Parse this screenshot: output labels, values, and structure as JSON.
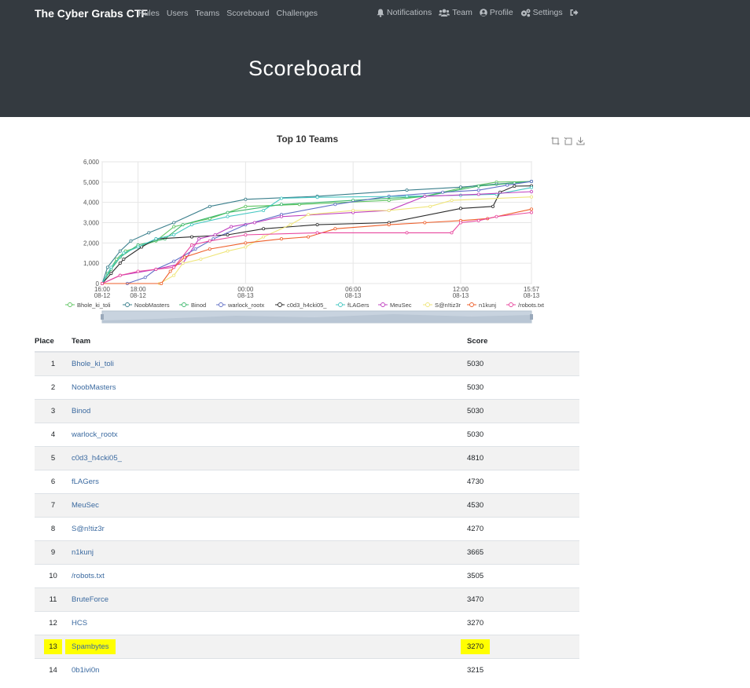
{
  "navbar": {
    "brand": "The Cyber Grabs CTF",
    "links": [
      "Rules",
      "Users",
      "Teams",
      "Scoreboard",
      "Challenges"
    ],
    "right": {
      "notifications": "Notifications",
      "team": "Team",
      "profile": "Profile",
      "settings": "Settings"
    }
  },
  "page": {
    "title": "Scoreboard"
  },
  "table": {
    "headers": {
      "place": "Place",
      "team": "Team",
      "score": "Score"
    },
    "rows": [
      {
        "place": "1",
        "team": "Bhole_ki_toli",
        "score": "5030"
      },
      {
        "place": "2",
        "team": "NoobMasters",
        "score": "5030"
      },
      {
        "place": "3",
        "team": "Binod",
        "score": "5030"
      },
      {
        "place": "4",
        "team": "warlock_rootx",
        "score": "5030"
      },
      {
        "place": "5",
        "team": "c0d3_h4cki05_",
        "score": "4810"
      },
      {
        "place": "6",
        "team": "fLAGers",
        "score": "4730"
      },
      {
        "place": "7",
        "team": "MeuSec",
        "score": "4530"
      },
      {
        "place": "8",
        "team": "S@n!tiz3r",
        "score": "4270"
      },
      {
        "place": "9",
        "team": "n1kunj",
        "score": "3665"
      },
      {
        "place": "10",
        "team": "/robots.txt",
        "score": "3505"
      },
      {
        "place": "11",
        "team": "BruteForce",
        "score": "3470"
      },
      {
        "place": "12",
        "team": "HCS",
        "score": "3270"
      },
      {
        "place": "13",
        "team": "Spambytes",
        "score": "3270",
        "highlighted": true
      },
      {
        "place": "14",
        "team": "0b1ivi0n",
        "score": "3215"
      }
    ]
  },
  "chart_data": {
    "type": "line",
    "title": "Top 10 Teams",
    "xlabel": "",
    "ylabel": "",
    "ylim": [
      0,
      6000
    ],
    "xlim_hours": [
      0,
      23.95
    ],
    "y_ticks": [
      "0",
      "1,000",
      "2,000",
      "3,000",
      "4,000",
      "5,000",
      "6,000"
    ],
    "x_ticks": [
      {
        "h": 0,
        "time": "16:00",
        "date": "08-12"
      },
      {
        "h": 2,
        "time": "18:00",
        "date": "08-12"
      },
      {
        "h": 8,
        "time": "00:00",
        "date": "08-13"
      },
      {
        "h": 14,
        "time": "06:00",
        "date": "08-13"
      },
      {
        "h": 20,
        "time": "12:00",
        "date": "08-13"
      },
      {
        "h": 23.95,
        "time": "15:57",
        "date": "08-13"
      }
    ],
    "grid": true,
    "legend_position": "bottom",
    "series": [
      {
        "name": "Bhole_ki_toli",
        "color": "#5ec460",
        "points": [
          [
            0,
            0
          ],
          [
            0.3,
            500
          ],
          [
            0.8,
            1200
          ],
          [
            1.3,
            1600
          ],
          [
            2,
            1800
          ],
          [
            3,
            2100
          ],
          [
            4,
            2800
          ],
          [
            6,
            3200
          ],
          [
            8,
            3800
          ],
          [
            11,
            3900
          ],
          [
            16,
            4100
          ],
          [
            18,
            4300
          ],
          [
            20,
            4700
          ],
          [
            22,
            5000
          ],
          [
            23.95,
            5030
          ]
        ]
      },
      {
        "name": "NoobMasters",
        "color": "#3a7f8c",
        "points": [
          [
            0,
            0
          ],
          [
            0.3,
            800
          ],
          [
            1,
            1600
          ],
          [
            1.6,
            2100
          ],
          [
            2.6,
            2500
          ],
          [
            4,
            3000
          ],
          [
            6,
            3800
          ],
          [
            8,
            4150
          ],
          [
            12,
            4300
          ],
          [
            17,
            4600
          ],
          [
            20,
            4750
          ],
          [
            22,
            4900
          ],
          [
            23.95,
            5030
          ]
        ]
      },
      {
        "name": "Binod",
        "color": "#3db86d",
        "points": [
          [
            0,
            0
          ],
          [
            0.5,
            700
          ],
          [
            1,
            1300
          ],
          [
            2,
            1900
          ],
          [
            3.5,
            2200
          ],
          [
            4.5,
            2900
          ],
          [
            7,
            3500
          ],
          [
            10,
            3900
          ],
          [
            14,
            4100
          ],
          [
            18,
            4300
          ],
          [
            21,
            4800
          ],
          [
            23,
            4950
          ],
          [
            23.95,
            5030
          ]
        ]
      },
      {
        "name": "warlock_rootx",
        "color": "#6170c6",
        "points": [
          [
            0,
            0
          ],
          [
            1.4,
            0
          ],
          [
            2.4,
            300
          ],
          [
            3,
            700
          ],
          [
            4,
            1100
          ],
          [
            5.2,
            1700
          ],
          [
            6.2,
            2200
          ],
          [
            8,
            2900
          ],
          [
            10,
            3400
          ],
          [
            13,
            3900
          ],
          [
            16,
            4300
          ],
          [
            19,
            4500
          ],
          [
            21,
            4600
          ],
          [
            22.6,
            4850
          ],
          [
            23.95,
            5030
          ]
        ]
      },
      {
        "name": "c0d3_h4cki05_",
        "color": "#2b2b2b",
        "points": [
          [
            0,
            0
          ],
          [
            0.5,
            500
          ],
          [
            1,
            1000
          ],
          [
            1.2,
            1200
          ],
          [
            2.2,
            1800
          ],
          [
            3,
            2200
          ],
          [
            5,
            2300
          ],
          [
            7,
            2400
          ],
          [
            9,
            2700
          ],
          [
            12,
            2900
          ],
          [
            16,
            3000
          ],
          [
            20,
            3700
          ],
          [
            21.8,
            3800
          ],
          [
            22.2,
            4500
          ],
          [
            23,
            4800
          ],
          [
            23.95,
            4810
          ]
        ]
      },
      {
        "name": "fLAGers",
        "color": "#45c7c2",
        "points": [
          [
            0,
            0
          ],
          [
            0.5,
            800
          ],
          [
            1.2,
            1500
          ],
          [
            2,
            1800
          ],
          [
            3,
            2200
          ],
          [
            4,
            2400
          ],
          [
            5,
            2900
          ],
          [
            7,
            3300
          ],
          [
            9,
            3600
          ],
          [
            10,
            4200
          ],
          [
            12,
            4250
          ],
          [
            17,
            4300
          ],
          [
            20,
            4350
          ],
          [
            22,
            4400
          ],
          [
            23.95,
            4730
          ]
        ]
      },
      {
        "name": "MeuSec",
        "color": "#c040c0",
        "points": [
          [
            0,
            0
          ],
          [
            1,
            400
          ],
          [
            3,
            700
          ],
          [
            4.5,
            1000
          ],
          [
            5.4,
            2200
          ],
          [
            6.3,
            2400
          ],
          [
            7.2,
            2800
          ],
          [
            8.5,
            3000
          ],
          [
            10,
            3300
          ],
          [
            14,
            3500
          ],
          [
            16,
            3600
          ],
          [
            18,
            4300
          ],
          [
            21,
            4400
          ],
          [
            23.95,
            4530
          ]
        ]
      },
      {
        "name": "S@n!tiz3r",
        "color": "#efe57a",
        "points": [
          [
            0,
            0
          ],
          [
            3.2,
            0
          ],
          [
            4,
            400
          ],
          [
            4.5,
            1000
          ],
          [
            5.5,
            1200
          ],
          [
            7,
            1600
          ],
          [
            8,
            1800
          ],
          [
            9,
            2300
          ],
          [
            10.5,
            2900
          ],
          [
            11.5,
            3400
          ],
          [
            14,
            3600
          ],
          [
            16,
            3600
          ],
          [
            18.3,
            3800
          ],
          [
            19.5,
            4100
          ],
          [
            23.95,
            4270
          ]
        ]
      },
      {
        "name": "n1kunj",
        "color": "#ee5f2b",
        "points": [
          [
            0,
            0
          ],
          [
            3.3,
            0
          ],
          [
            3.8,
            600
          ],
          [
            4.6,
            1300
          ],
          [
            6,
            1700
          ],
          [
            8,
            2000
          ],
          [
            10,
            2200
          ],
          [
            11.5,
            2300
          ],
          [
            13,
            2700
          ],
          [
            16,
            2900
          ],
          [
            18,
            3000
          ],
          [
            20,
            3100
          ],
          [
            21.5,
            3200
          ],
          [
            23.95,
            3665
          ]
        ]
      },
      {
        "name": "/robots.txt",
        "color": "#e8479e",
        "points": [
          [
            0,
            0
          ],
          [
            1,
            400
          ],
          [
            2,
            600
          ],
          [
            3,
            700
          ],
          [
            4,
            800
          ],
          [
            5,
            1900
          ],
          [
            6,
            2100
          ],
          [
            8,
            2400
          ],
          [
            12,
            2500
          ],
          [
            17,
            2500
          ],
          [
            19.5,
            2500
          ],
          [
            20,
            3000
          ],
          [
            21,
            3100
          ],
          [
            22,
            3300
          ],
          [
            23.95,
            3505
          ]
        ]
      }
    ]
  }
}
